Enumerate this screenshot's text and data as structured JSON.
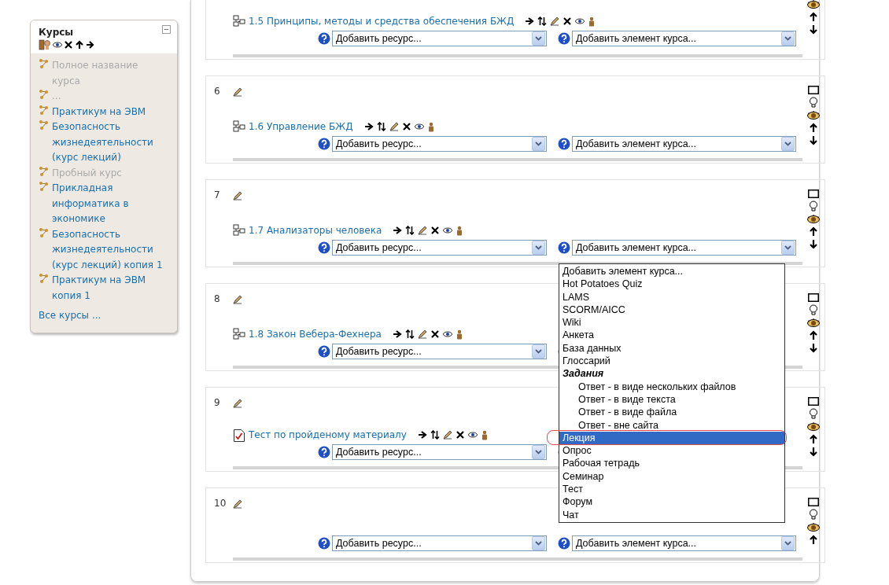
{
  "courses_block": {
    "title": "Курсы",
    "items": [
      {
        "label": "Полное название курса",
        "dimmed": true
      },
      {
        "label": "...",
        "dimmed": true
      },
      {
        "label": "Практикум на ЭВМ",
        "dimmed": false
      },
      {
        "label": "Безопасность жизнедеятельности (курс лекций)",
        "dimmed": false
      },
      {
        "label": "Пробный курс",
        "dimmed": true
      },
      {
        "label": "Прикладная информатика в экономике",
        "dimmed": false
      },
      {
        "label": "Безопасность жизнедеятельности (курс лекций) копия 1",
        "dimmed": false
      },
      {
        "label": "Практикум на ЭВМ копия 1",
        "dimmed": false
      }
    ],
    "all_link": "Все курсы ..."
  },
  "sections": [
    {
      "activities": [
        {
          "kind": "page",
          "title": "1.5 Принципы, методы и средства обеспечения БЖД"
        }
      ],
      "resource_select": "Добавить ресурс...",
      "element_select": "Добавить элемент курса...",
      "controls": [
        {
          "kind": "eye"
        },
        {
          "kind": "up"
        },
        {
          "kind": "down"
        }
      ]
    },
    {
      "number": "6",
      "activities": [
        {
          "kind": "page",
          "title": "1.6 Управление БЖД"
        }
      ],
      "resource_select": "Добавить ресурс...",
      "element_select": "Добавить элемент курса...",
      "controls": [
        {
          "kind": "square"
        },
        {
          "kind": "bulb"
        },
        {
          "kind": "eye"
        },
        {
          "kind": "up"
        },
        {
          "kind": "down"
        }
      ]
    },
    {
      "number": "7",
      "activities": [
        {
          "kind": "page",
          "title": "1.7 Анализаторы человека"
        }
      ],
      "resource_select": "Добавить ресурс...",
      "element_select": "Добавить элемент курса...",
      "controls": [
        {
          "kind": "square"
        },
        {
          "kind": "bulb"
        },
        {
          "kind": "eye"
        },
        {
          "kind": "up"
        },
        {
          "kind": "down"
        }
      ]
    },
    {
      "number": "8",
      "activities": [
        {
          "kind": "page",
          "title": "1.8 Закон Вебера-Фехнера"
        }
      ],
      "resource_select": "Добавить ресурс...",
      "controls": [
        {
          "kind": "square"
        },
        {
          "kind": "bulb"
        },
        {
          "kind": "eye"
        },
        {
          "kind": "up"
        },
        {
          "kind": "down"
        }
      ]
    },
    {
      "number": "9",
      "activities": [
        {
          "kind": "quiz",
          "title": "Тест по пройденому материалу"
        }
      ],
      "resource_select": "Добавить ресурс...",
      "controls": [
        {
          "kind": "square"
        },
        {
          "kind": "bulb"
        },
        {
          "kind": "eye"
        },
        {
          "kind": "up"
        },
        {
          "kind": "down"
        }
      ]
    },
    {
      "number": "10",
      "resource_select": "Добавить ресурс...",
      "element_select": "Добавить элемент курса...",
      "controls": [
        {
          "kind": "square"
        },
        {
          "kind": "bulb"
        },
        {
          "kind": "eye"
        },
        {
          "kind": "up"
        }
      ]
    }
  ],
  "dropdown": {
    "options": [
      {
        "kind": "option",
        "label": "Добавить элемент курса...",
        "selected": false
      },
      {
        "kind": "option",
        "label": "Hot Potatoes Quiz",
        "selected": false
      },
      {
        "kind": "option",
        "label": "LAMS",
        "selected": false
      },
      {
        "kind": "option",
        "label": "SCORM/AICC",
        "selected": false
      },
      {
        "kind": "option",
        "label": "Wiki",
        "selected": false
      },
      {
        "kind": "option",
        "label": "Анкета",
        "selected": false
      },
      {
        "kind": "option",
        "label": "База данных",
        "selected": false
      },
      {
        "kind": "option",
        "label": "Глоссарий",
        "selected": false
      },
      {
        "kind": "group",
        "label": "Задания",
        "children": [
          {
            "kind": "option",
            "label": "Ответ - в виде нескольких файлов",
            "selected": false
          },
          {
            "kind": "option",
            "label": "Ответ - в виде текста",
            "selected": false
          },
          {
            "kind": "option",
            "label": "Ответ - в виде файла",
            "selected": false
          },
          {
            "kind": "option",
            "label": "Ответ - вне сайта",
            "selected": false
          }
        ]
      },
      {
        "kind": "option",
        "label": "Лекция",
        "selected": true
      },
      {
        "kind": "option",
        "label": "Опрос",
        "selected": false
      },
      {
        "kind": "option",
        "label": "Рабочая тетрадь",
        "selected": false
      },
      {
        "kind": "option",
        "label": "Семинар",
        "selected": false
      },
      {
        "kind": "option",
        "label": "Тест",
        "selected": false
      },
      {
        "kind": "option",
        "label": "Форум",
        "selected": false
      },
      {
        "kind": "option",
        "label": "Чат",
        "selected": false
      }
    ]
  }
}
